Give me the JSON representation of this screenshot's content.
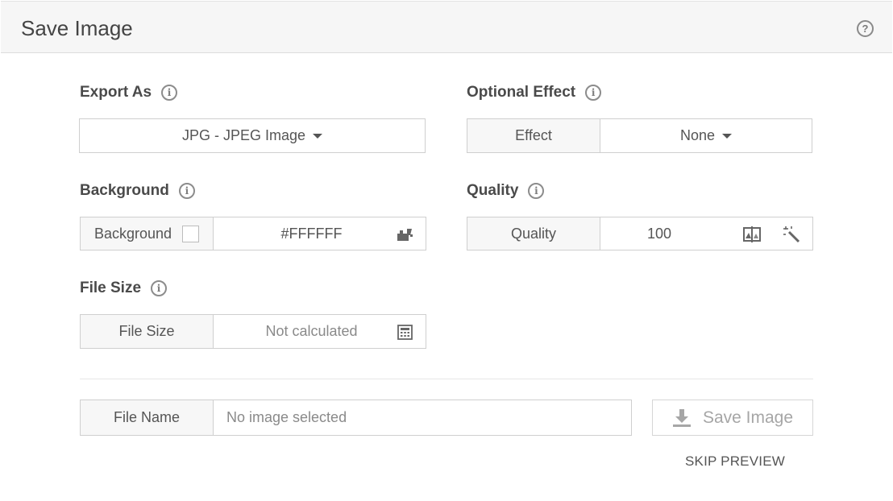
{
  "header": {
    "title": "Save Image",
    "help_icon": "question-circle-icon"
  },
  "export_as": {
    "label": "Export As",
    "info_glyph": "i",
    "selected": "JPG - JPEG Image"
  },
  "optional_effect": {
    "label": "Optional Effect",
    "info_glyph": "i",
    "field_label": "Effect",
    "selected": "None"
  },
  "background": {
    "label": "Background",
    "info_glyph": "i",
    "field_label": "Background",
    "checked": false,
    "color": "#FFFFFF",
    "picker_icon": "color-picker-icon"
  },
  "quality": {
    "label": "Quality",
    "info_glyph": "i",
    "field_label": "Quality",
    "value": "100",
    "compare_icon": "compare-icon",
    "auto_icon": "magic-wand-icon"
  },
  "file_size": {
    "label": "File Size",
    "info_glyph": "i",
    "field_label": "File Size",
    "value": "Not calculated",
    "calc_icon": "calculator-icon"
  },
  "file_name": {
    "field_label": "File Name",
    "placeholder": "No image selected"
  },
  "actions": {
    "save_label": "Save Image",
    "save_icon": "download-icon",
    "skip_label": "SKIP PREVIEW"
  },
  "colors": {
    "header_bg": "#f6f6f6",
    "label_bg": "#f7f7f7",
    "border": "#cfcfcf",
    "text": "#444444",
    "disabled_text": "#a6a6a6"
  }
}
